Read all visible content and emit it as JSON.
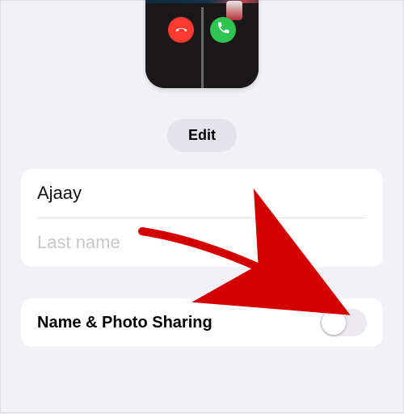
{
  "edit_button_label": "Edit",
  "contact": {
    "first_name": "Ajaay",
    "last_name_placeholder": "Last name"
  },
  "sharing": {
    "label": "Name & Photo Sharing",
    "enabled": false
  },
  "call_preview": {
    "decline_icon": "phone-down-icon",
    "accept_icon": "phone-icon"
  }
}
